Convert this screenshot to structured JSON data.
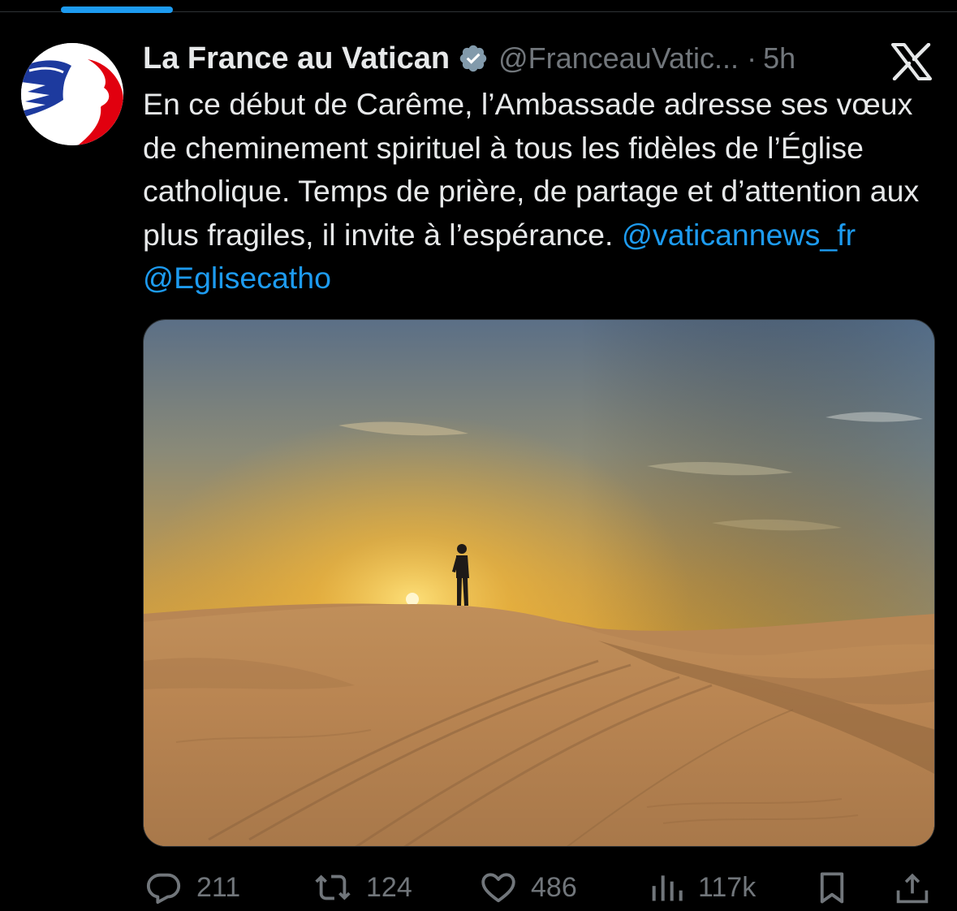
{
  "colors": {
    "background": "#000000",
    "text": "#e7e9ea",
    "secondary_text": "#71767b",
    "link": "#1d9bf0",
    "verified_badge": "#829aab"
  },
  "tweet": {
    "display_name": "La France au Vatican",
    "verified_icon": "verified-badge-icon",
    "handle": "@FranceauVatic...",
    "separator": "·",
    "time": "5h",
    "brand_icon": "x-logo-icon",
    "text": "En ce début de Carême, l’Ambassade adresse ses vœux de cheminement spirituel à tous les fidèles de l’Église catholique. Temps de prière, de partage et d’attention aux plus fragiles, il invite à l’espérance.",
    "mentions": [
      "@vaticannews_fr",
      "@Eglisecatho"
    ],
    "media_description_icon": "desert-sunset-photo"
  },
  "actions": {
    "replies": {
      "icon": "reply-icon",
      "count": "211"
    },
    "reposts": {
      "icon": "repost-icon",
      "count": "124"
    },
    "likes": {
      "icon": "like-icon",
      "count": "486"
    },
    "views": {
      "icon": "views-icon",
      "count": "117k"
    },
    "bookmark": {
      "icon": "bookmark-icon"
    },
    "share": {
      "icon": "share-icon"
    }
  }
}
